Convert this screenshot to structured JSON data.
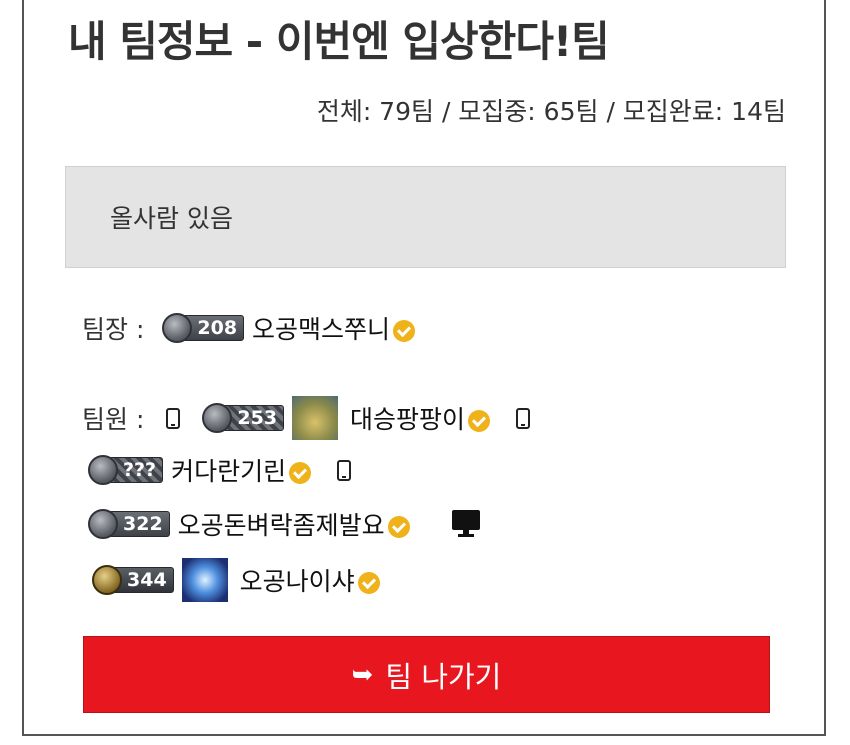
{
  "header": {
    "title": "내 팀정보 - 이번엔 입상한다!팀",
    "stats": "전체: 79팀 / 모집중: 65팀 / 모집완료: 14팀"
  },
  "description": "올사람 있음",
  "leader": {
    "label": "팀장 :",
    "level": "208",
    "name": "오공맥스쭈니"
  },
  "members_label": "팀원 :",
  "members": [
    {
      "level": "253",
      "name": "대승팡팡이",
      "device_before": "phone-icon",
      "device_after": "phone-icon"
    },
    {
      "level": "???",
      "name": "커다란기린",
      "device_after": "phone-icon"
    },
    {
      "level": "322",
      "name": "오공돈벼락좀제발요",
      "device_after": "desktop-icon"
    },
    {
      "level": "344",
      "name": "오공나이샤"
    }
  ],
  "actions": {
    "leave_label": "팀 나가기",
    "leave_icon": "sign-out-icon"
  },
  "colors": {
    "accent_red": "#e8171f",
    "verified_gold": "#f0b21a",
    "desc_bg": "#e4e4e4"
  }
}
